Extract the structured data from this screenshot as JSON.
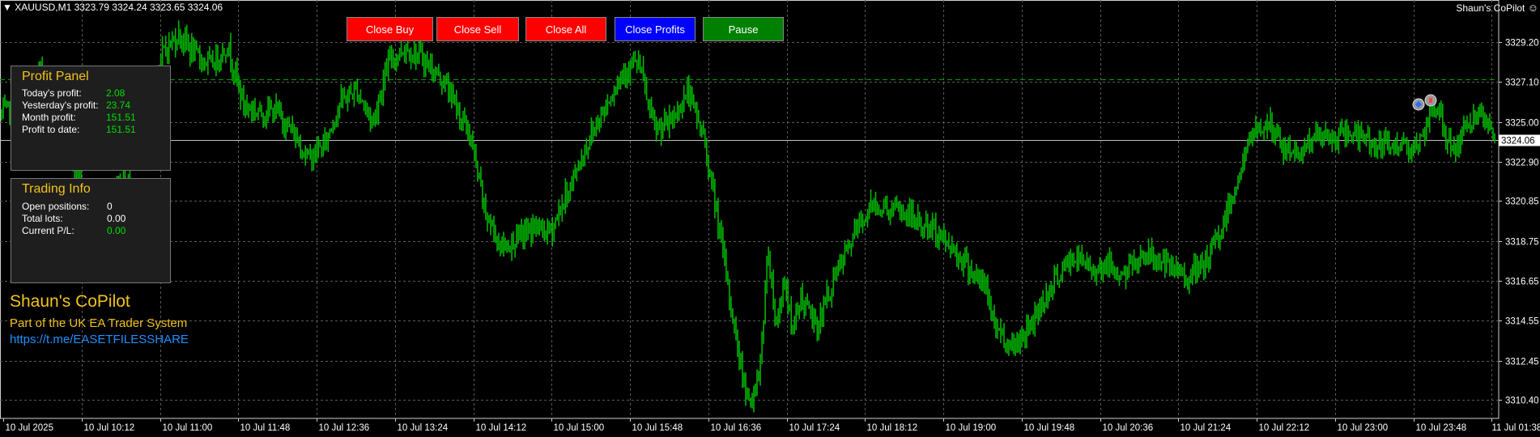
{
  "chart_header": {
    "symbol_info": "XAUUSD,M1  3323.79 3324.24 3323.65 3324.06",
    "ea_name": "Shaun's CoPilot",
    "ea_icon": "smiley-icon"
  },
  "buttons": {
    "close_buy": {
      "label": "Close Buy",
      "color": "#ff0000"
    },
    "close_sell": {
      "label": "Close Sell",
      "color": "#ff0000"
    },
    "close_all": {
      "label": "Close All",
      "color": "#ff0000"
    },
    "close_profits": {
      "label": "Close Profits",
      "color": "#0000ff"
    },
    "pause": {
      "label": "Pause",
      "color": "#008000"
    }
  },
  "profit_panel": {
    "title": "Profit Panel",
    "rows": [
      {
        "label": "Today's profit:",
        "value": "2.08"
      },
      {
        "label": "Yesterday's profit:",
        "value": "23.74"
      },
      {
        "label": "Month profit:",
        "value": "151.51"
      },
      {
        "label": "Profit to date:",
        "value": "151.51"
      }
    ]
  },
  "trading_info": {
    "title": "Trading Info",
    "rows": [
      {
        "label": "Open positions:",
        "value": "0",
        "value_color": "#ffffff"
      },
      {
        "label": "Total lots:",
        "value": "0.00",
        "value_color": "#ffffff"
      },
      {
        "label": "Current P/L:",
        "value": "0.00",
        "value_color": "#00e000"
      }
    ]
  },
  "branding": {
    "name": "Shaun's CoPilot",
    "tagline": "Part of the UK EA Trader System",
    "link": "https://t.me/EASETFILESSHARE"
  },
  "colors": {
    "background": "#000000",
    "candles": "#00b400",
    "grid": "#5a5a5a",
    "accent_yellow": "#f2c21b",
    "profit_green": "#00e000",
    "link_blue": "#1e90ff"
  },
  "chart_data": {
    "type": "candlestick",
    "symbol": "XAUUSD",
    "timeframe": "M1",
    "current_price": 3324.06,
    "ylim": [
      3309.6,
      3330.9
    ],
    "price_ticks": [
      3329.2,
      3327.1,
      3325.0,
      3322.9,
      3320.85,
      3318.75,
      3316.65,
      3314.55,
      3312.45,
      3310.4
    ],
    "price_tick_labels": [
      "3329.20",
      "3327.10",
      "3325.00",
      "3322.90",
      "3320.85",
      "3318.75",
      "3316.65",
      "3314.55",
      "3312.45",
      "3310.40"
    ],
    "current_price_label": "3324.06",
    "time_labels": [
      "10 Jul 2025",
      "10 Jul 10:12",
      "10 Jul 11:00",
      "10 Jul 11:48",
      "10 Jul 12:36",
      "10 Jul 13:24",
      "10 Jul 14:12",
      "10 Jul 15:00",
      "10 Jul 15:48",
      "10 Jul 16:36",
      "10 Jul 17:24",
      "10 Jul 18:12",
      "10 Jul 19:00",
      "10 Jul 19:48",
      "10 Jul 20:36",
      "10 Jul 21:24",
      "10 Jul 22:12",
      "10 Jul 23:00",
      "10 Jul 23:48",
      "11 Jul 01:38"
    ],
    "price_path": [
      [
        0,
        3325.4
      ],
      [
        3,
        3326.2
      ],
      [
        5,
        3327.8
      ],
      [
        7,
        3325.0
      ],
      [
        10,
        3321.6
      ],
      [
        12,
        3320.7
      ],
      [
        15,
        3321.8
      ],
      [
        17,
        3323.4
      ],
      [
        20,
        3328.7
      ],
      [
        22,
        3329.6
      ],
      [
        24,
        3328.5
      ],
      [
        26,
        3328.0
      ],
      [
        28,
        3329.0
      ],
      [
        30,
        3325.9
      ],
      [
        32,
        3325.5
      ],
      [
        34,
        3325.6
      ],
      [
        36,
        3324.5
      ],
      [
        38,
        3323.1
      ],
      [
        40,
        3323.8
      ],
      [
        42,
        3326.1
      ],
      [
        44,
        3326.7
      ],
      [
        46,
        3325.0
      ],
      [
        48,
        3328.2
      ],
      [
        50,
        3328.9
      ],
      [
        52,
        3328.4
      ],
      [
        55,
        3327.0
      ],
      [
        58,
        3324.3
      ],
      [
        60,
        3320.1
      ],
      [
        62,
        3318.4
      ],
      [
        64,
        3318.9
      ],
      [
        66,
        3319.5
      ],
      [
        68,
        3319.2
      ],
      [
        71,
        3322.2
      ],
      [
        73,
        3324.3
      ],
      [
        75,
        3326.0
      ],
      [
        77,
        3327.7
      ],
      [
        79,
        3328.1
      ],
      [
        80,
        3326.1
      ],
      [
        81,
        3324.5
      ],
      [
        83,
        3325.0
      ],
      [
        85,
        3326.6
      ],
      [
        87,
        3324.2
      ],
      [
        89,
        3319.1
      ],
      [
        91,
        3313.6
      ],
      [
        92,
        3311.3
      ],
      [
        93,
        3310.0
      ],
      [
        94,
        3312.4
      ],
      [
        95,
        3318.4
      ],
      [
        96,
        3314.2
      ],
      [
        97,
        3316.9
      ],
      [
        98,
        3313.8
      ],
      [
        99,
        3315.9
      ],
      [
        101,
        3314.2
      ],
      [
        103,
        3316.6
      ],
      [
        106,
        3319.4
      ],
      [
        108,
        3320.7
      ],
      [
        110,
        3320.4
      ],
      [
        112,
        3320.2
      ],
      [
        114,
        3319.6
      ],
      [
        116,
        3319.2
      ],
      [
        118,
        3318.3
      ],
      [
        120,
        3317.3
      ],
      [
        122,
        3316.2
      ],
      [
        123,
        3314.4
      ],
      [
        125,
        3313.2
      ],
      [
        127,
        3314.0
      ],
      [
        129,
        3315.6
      ],
      [
        131,
        3317.0
      ],
      [
        133,
        3317.9
      ],
      [
        135,
        3317.3
      ],
      [
        137,
        3317.5
      ],
      [
        139,
        3316.9
      ],
      [
        141,
        3318.0
      ],
      [
        143,
        3317.9
      ],
      [
        145,
        3317.2
      ],
      [
        147,
        3316.9
      ],
      [
        149,
        3317.4
      ],
      [
        151,
        3319.2
      ],
      [
        153,
        3321.8
      ],
      [
        155,
        3324.4
      ],
      [
        157,
        3324.9
      ],
      [
        159,
        3323.5
      ],
      [
        161,
        3323.5
      ],
      [
        163,
        3324.3
      ],
      [
        165,
        3324.0
      ],
      [
        167,
        3324.5
      ],
      [
        169,
        3324.1
      ],
      [
        171,
        3323.7
      ],
      [
        173,
        3323.8
      ],
      [
        175,
        3323.8
      ],
      [
        176,
        3323.9
      ],
      [
        177,
        3325.2
      ],
      [
        178,
        3325.9
      ],
      [
        179,
        3324.2
      ],
      [
        180,
        3323.5
      ],
      [
        182,
        3325.2
      ],
      [
        184,
        3324.9
      ],
      [
        185,
        3324.06
      ]
    ]
  }
}
